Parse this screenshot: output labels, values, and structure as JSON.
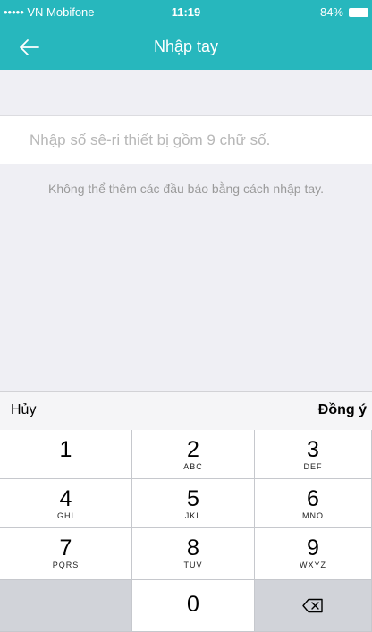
{
  "status_bar": {
    "carrier": "••••• VN Mobifone",
    "time": "11:19",
    "battery": "84%"
  },
  "nav": {
    "title": "Nhập tay",
    "back_icon": "arrow-left-icon"
  },
  "serial_input": {
    "placeholder": "Nhập số sê-ri thiết bị gồm 9 chữ số.",
    "value": ""
  },
  "note": "Không thể thêm các đầu báo bằng cách nhập tay.",
  "keyboard_toolbar": {
    "cancel_label": "Hủy",
    "confirm_label": "Đồng ý"
  },
  "keypad": {
    "keys": [
      {
        "digit": "1",
        "letters": ""
      },
      {
        "digit": "2",
        "letters": "ABC"
      },
      {
        "digit": "3",
        "letters": "DEF"
      },
      {
        "digit": "4",
        "letters": "GHI"
      },
      {
        "digit": "5",
        "letters": "JKL"
      },
      {
        "digit": "6",
        "letters": "MNO"
      },
      {
        "digit": "7",
        "letters": "PQRS"
      },
      {
        "digit": "8",
        "letters": "TUV"
      },
      {
        "digit": "9",
        "letters": "WXYZ"
      },
      {
        "digit": "0",
        "letters": ""
      }
    ],
    "delete_icon": "backspace-icon"
  },
  "colors": {
    "brand": "#27b7bd",
    "background": "#efeff4",
    "keypad_bg": "#d1d3d9"
  }
}
